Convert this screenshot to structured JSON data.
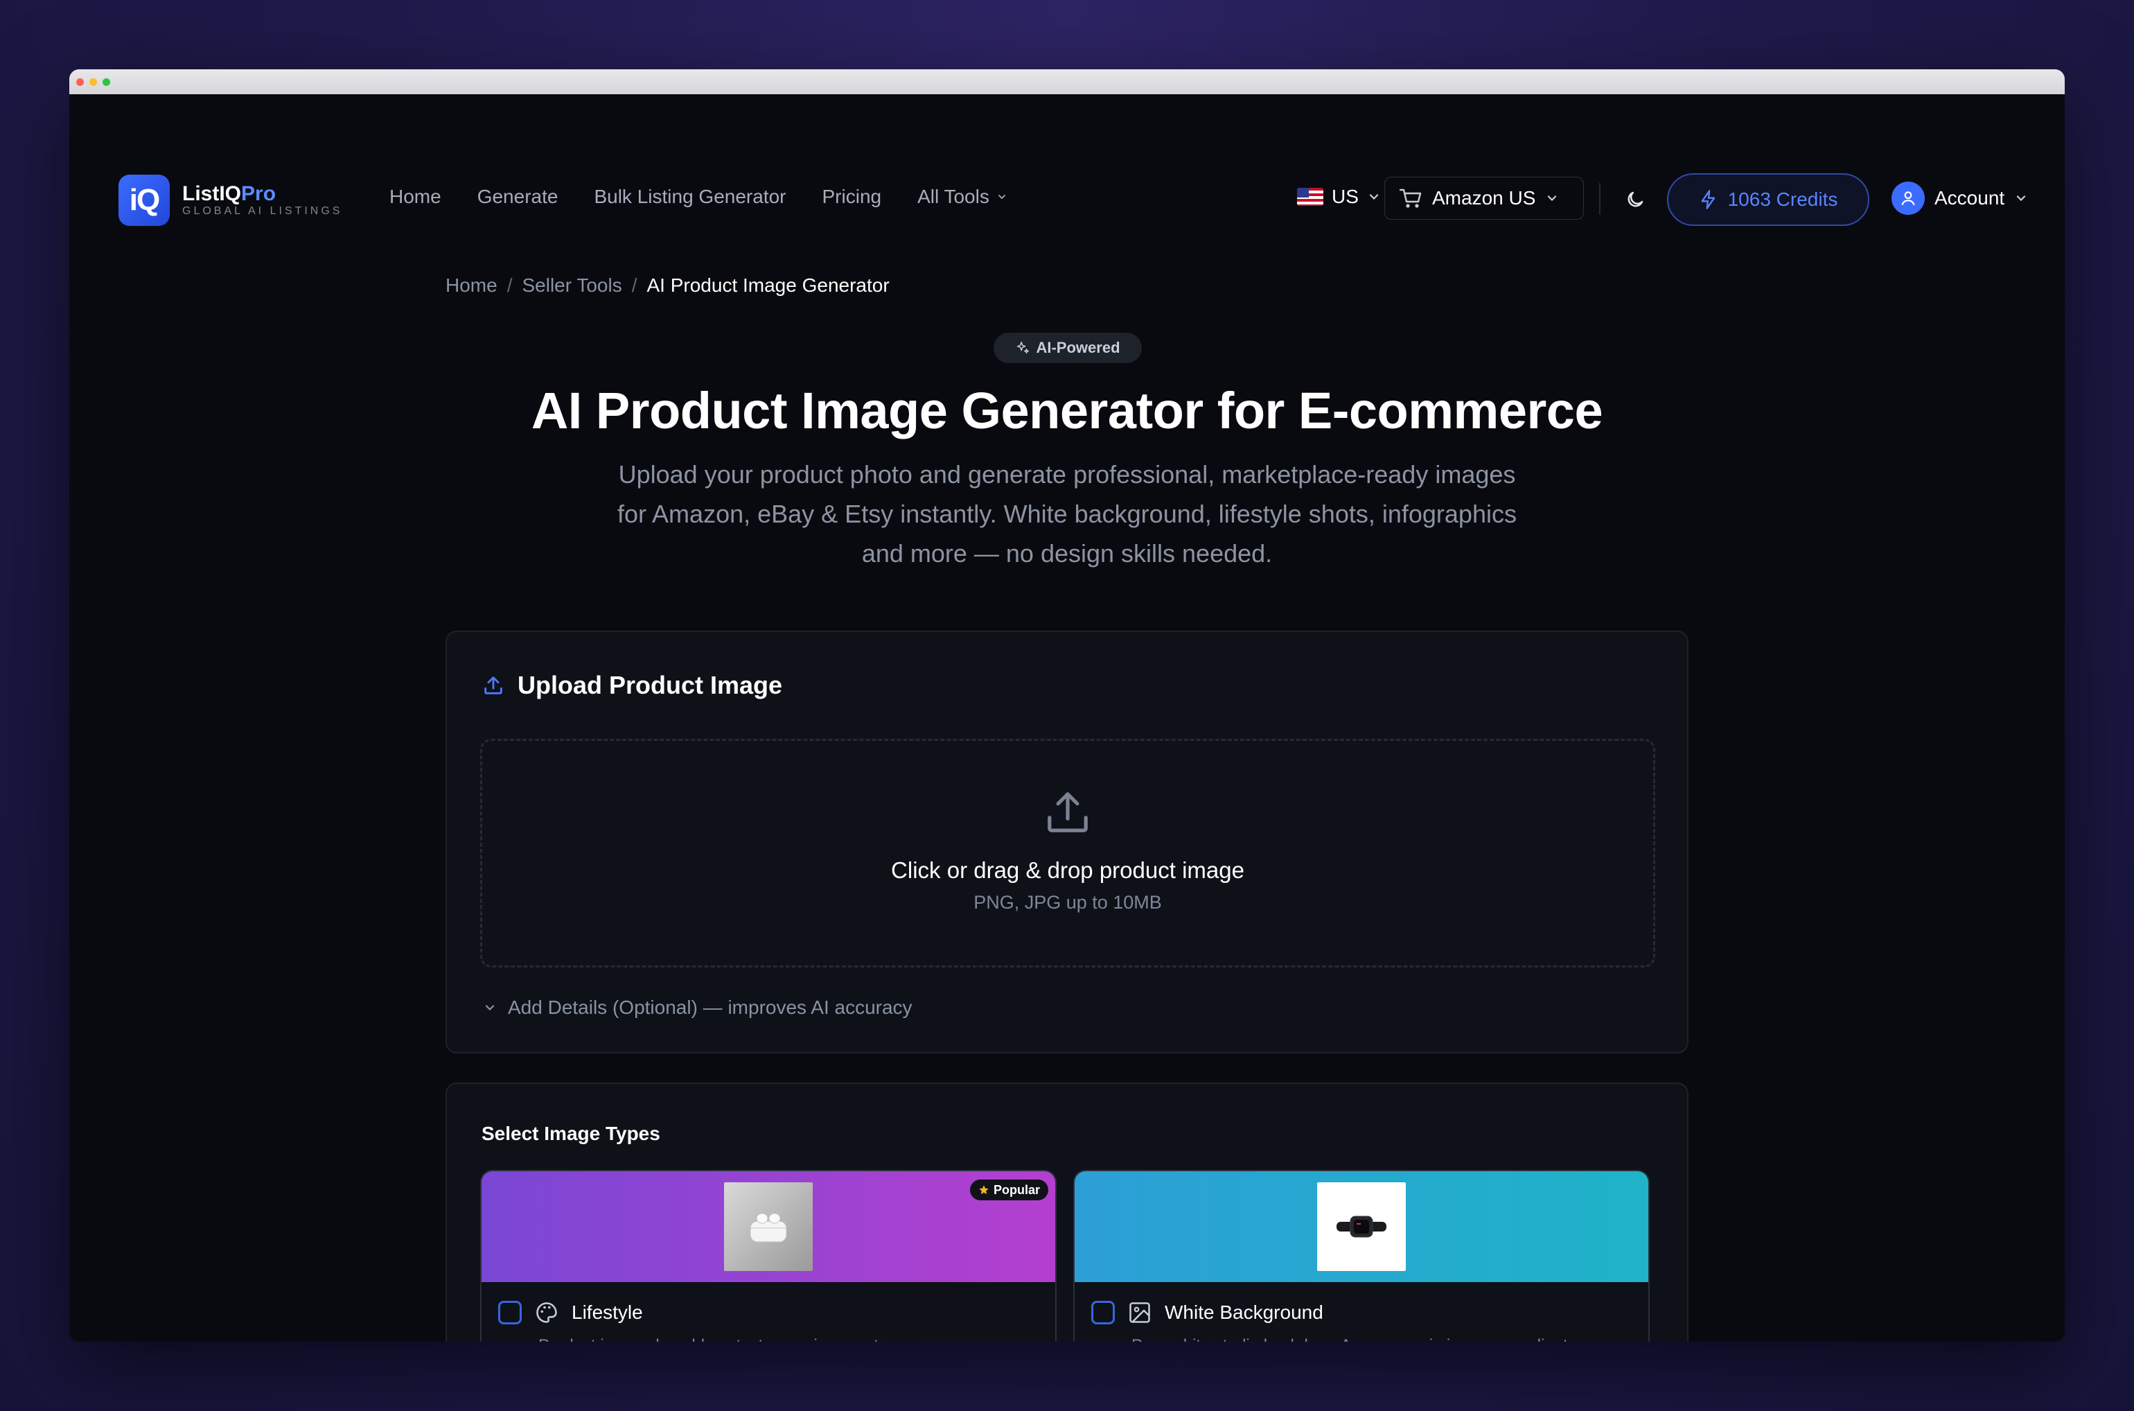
{
  "brand": {
    "name": "ListIQ",
    "suffix": "Pro",
    "tagline": "GLOBAL AI LISTINGS",
    "logo_glyph": "iQ"
  },
  "nav": {
    "links": [
      "Home",
      "Generate",
      "Bulk Listing Generator",
      "Pricing"
    ],
    "all_tools": "All Tools"
  },
  "region": {
    "code": "US"
  },
  "marketplace": {
    "label": "Amazon US"
  },
  "credits": {
    "label": "1063 Credits"
  },
  "account": {
    "label": "Account"
  },
  "breadcrumb": {
    "home": "Home",
    "section": "Seller Tools",
    "current": "AI Product Image Generator",
    "sep": "/"
  },
  "badge": {
    "label": "AI-Powered"
  },
  "hero": {
    "title": "AI Product Image Generator for E-commerce",
    "subtitle": "Upload your product photo and generate professional, marketplace-ready images for Amazon, eBay & Etsy instantly. White background, lifestyle shots, infographics and more — no design skills needed."
  },
  "upload": {
    "heading": "Upload Product Image",
    "drop_main": "Click or drag & drop product image",
    "drop_sub": "PNG, JPG up to 10MB",
    "details_toggle": "Add Details (Optional) — improves AI accuracy"
  },
  "types": {
    "heading": "Select Image Types",
    "items": [
      {
        "name": "Lifestyle",
        "desc": "Product in a real-world context or environment",
        "badge": "Popular"
      },
      {
        "name": "White Background",
        "desc": "Pure white studio backdrop, Amazon main image compliant"
      }
    ]
  },
  "colors": {
    "accent": "#3b6cff",
    "credits_text": "#5a84ff",
    "bg": "#090a0f",
    "card": "#0e1118"
  }
}
